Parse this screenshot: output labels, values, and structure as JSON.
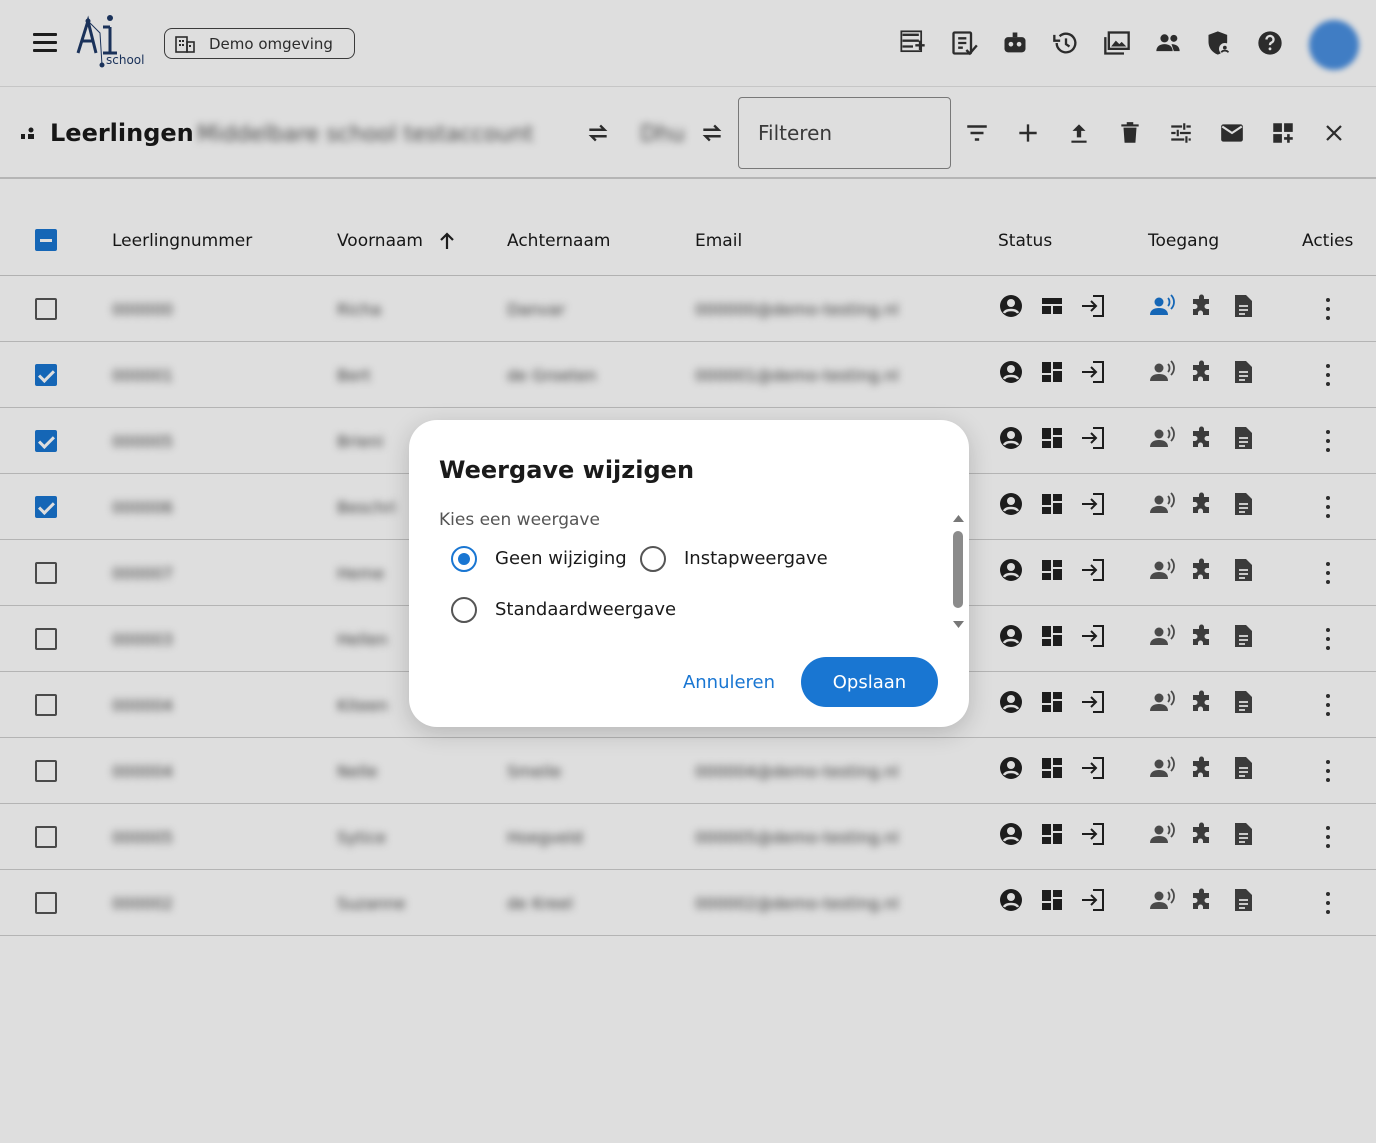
{
  "app": {
    "logo_text": "school",
    "environment_chip": "Demo omgeving",
    "top_icons": [
      "list-add-icon",
      "assignment-icon",
      "robot-icon",
      "history-icon",
      "photos-icon",
      "people-icon",
      "admin-shield-icon",
      "help-icon"
    ]
  },
  "toolbar": {
    "title": "Leerlingen",
    "school_name": "Middelbare school testaccount",
    "year": "Dhu",
    "filter_placeholder": "Filteren",
    "actions": [
      "filter-icon",
      "add-icon",
      "upload-icon",
      "delete-icon",
      "tune-icon",
      "mail-icon",
      "add-widget-icon",
      "close-icon"
    ]
  },
  "table": {
    "columns": [
      "Leerlingnummer",
      "Voornaam",
      "Achternaam",
      "Email",
      "Status",
      "Toegang",
      "Acties"
    ],
    "sort_column": "Voornaam",
    "rows": [
      {
        "checked": false,
        "number": "000000",
        "first": "Richa",
        "last": "Danvar",
        "email": "000000@demo-testing.nl",
        "access_active": true
      },
      {
        "checked": true,
        "number": "000001",
        "first": "Bert",
        "last": "de Groeten",
        "email": "000001@demo-testing.nl",
        "access_active": false
      },
      {
        "checked": true,
        "number": "000005",
        "first": "Brieni",
        "last": "",
        "email": "",
        "access_active": false
      },
      {
        "checked": true,
        "number": "000006",
        "first": "Beschri",
        "last": "",
        "email": "",
        "access_active": false
      },
      {
        "checked": false,
        "number": "000007",
        "first": "Heme",
        "last": "",
        "email": "",
        "access_active": false
      },
      {
        "checked": false,
        "number": "000003",
        "first": "Hellen",
        "last": "",
        "email": "",
        "access_active": false
      },
      {
        "checked": false,
        "number": "000004",
        "first": "Kiteen",
        "last": "",
        "email": "",
        "access_active": false
      },
      {
        "checked": false,
        "number": "000004",
        "first": "Nelle",
        "last": "Smeile",
        "email": "000004@demo-testing.nl",
        "access_active": false
      },
      {
        "checked": false,
        "number": "000005",
        "first": "Sytice",
        "last": "Hoegveld",
        "email": "000005@demo-testing.nl",
        "access_active": false
      },
      {
        "checked": false,
        "number": "000002",
        "first": "Suzanne",
        "last": "de Kreel",
        "email": "000002@demo-testing.nl",
        "access_active": false
      }
    ]
  },
  "dialog": {
    "title": "Weergave wijzigen",
    "subtitle": "Kies een weergave",
    "options": [
      "Geen wijziging",
      "Instapweergave",
      "Standaardweergave"
    ],
    "selected": "Geen wijziging",
    "cancel": "Annuleren",
    "save": "Opslaan"
  },
  "colors": {
    "accent": "#1976d2"
  }
}
